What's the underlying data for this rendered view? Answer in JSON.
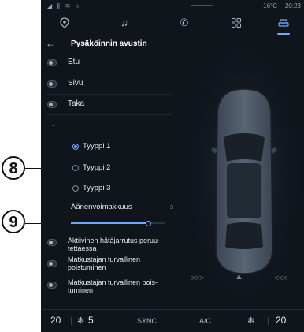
{
  "status_bar": {
    "left_icons": "◢ ∦ ≋ ♁",
    "temperature": "16°C",
    "time": "20:23"
  },
  "nav": {
    "tabs": [
      {
        "name": "navigation",
        "icon": "location-pin-icon",
        "glyph": "⬤"
      },
      {
        "name": "music",
        "icon": "music-note-icon",
        "glyph": "♫"
      },
      {
        "name": "phone",
        "icon": "phone-icon",
        "glyph": "✆"
      },
      {
        "name": "apps",
        "icon": "apps-grid-icon",
        "glyph": "▦"
      },
      {
        "name": "vehicle",
        "icon": "car-icon",
        "glyph": "⛟",
        "active": true
      }
    ]
  },
  "header": {
    "back_glyph": "←",
    "title": "Pysäköinnin avustin"
  },
  "toggles": [
    {
      "label": "Etu"
    },
    {
      "label": "Sivu"
    },
    {
      "label": "Taka"
    }
  ],
  "chevron_glyph": "⌄",
  "sound_types": [
    {
      "label": "Tyyppi 1",
      "checked": true
    },
    {
      "label": "Tyyppi 2",
      "checked": false
    },
    {
      "label": "Tyyppi 3",
      "checked": false
    }
  ],
  "volume": {
    "label": "Äänenvoimakkuus",
    "value": "3",
    "level": 0.82
  },
  "extra_toggles": [
    {
      "label": "Aktiivinen hätäjarrutus peruu-",
      "label2": "tettaessa"
    },
    {
      "label": "Matkustajan turvallinen",
      "label2": "poistuminen"
    },
    {
      "label": "Matkustajan turvallinen pois-",
      "label2": "tuminen"
    }
  ],
  "callouts": {
    "c8": "8",
    "c9": "9"
  },
  "car_view": {
    "left_arrows": ">>>",
    "right_arrows": "<<<",
    "warning_glyph": "▲"
  },
  "bottom_bar": {
    "left_temp": "20",
    "fan_glyph": "✻",
    "fan_value": "5",
    "sync": "SYNC",
    "ac": "A/C",
    "right_temp": "20"
  },
  "colors": {
    "accent": "#6fa7ff",
    "screen_bg": "#10151c"
  }
}
